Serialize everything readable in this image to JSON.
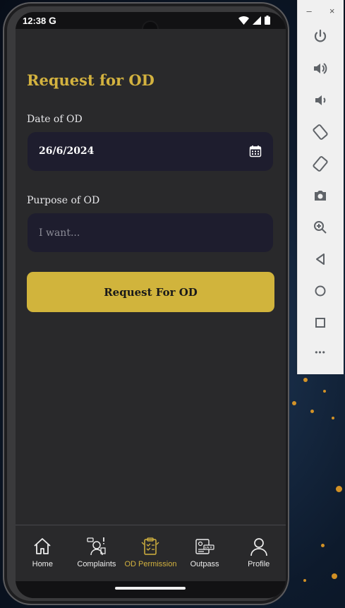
{
  "status_bar": {
    "time": "12:38",
    "google_badge": "G"
  },
  "page": {
    "title": "Request for OD",
    "date_label": "Date of OD",
    "date_value": "26/6/2024",
    "purpose_label": "Purpose of OD",
    "purpose_placeholder": "I want...",
    "submit_label": "Request For OD"
  },
  "bottom_nav": {
    "items": [
      {
        "label": "Home",
        "icon": "home-icon"
      },
      {
        "label": "Complaints",
        "icon": "complaints-icon"
      },
      {
        "label": "OD Permission",
        "icon": "od-permission-icon"
      },
      {
        "label": "Outpass",
        "icon": "outpass-icon"
      },
      {
        "label": "Profile",
        "icon": "profile-icon"
      }
    ],
    "active_item": "OD Permission"
  },
  "emulator_toolbar": {
    "minimize": "–",
    "close": "×",
    "more": "•••"
  },
  "colors": {
    "accent": "#d1b43c",
    "background": "#29292b",
    "field": "#1e1d2e"
  }
}
